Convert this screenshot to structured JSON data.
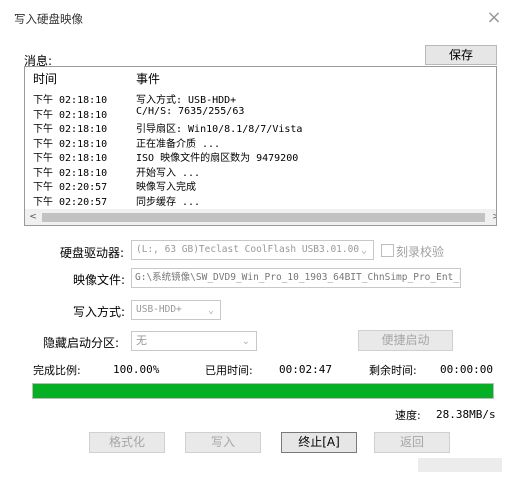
{
  "window": {
    "title": "写入硬盘映像",
    "close_glyph": "×"
  },
  "log": {
    "label": "消息:",
    "save_button": "保存",
    "columns": {
      "time": "时间",
      "event": "事件"
    },
    "rows": [
      {
        "time": "下午 02:18:10",
        "event": "写入方式: USB-HDD+"
      },
      {
        "time": "下午 02:18:10",
        "event": "C/H/S: 7635/255/63"
      },
      {
        "time": "下午 02:18:10",
        "event": "引导扇区: Win10/8.1/8/7/Vista"
      },
      {
        "time": "下午 02:18:10",
        "event": "正在准备介质 ..."
      },
      {
        "time": "下午 02:18:10",
        "event": "ISO 映像文件的扇区数为 9479200"
      },
      {
        "time": "下午 02:18:10",
        "event": "开始写入 ..."
      },
      {
        "time": "下午 02:20:57",
        "event": "映像写入完成"
      },
      {
        "time": "下午 02:20:57",
        "event": "同步缓存 ..."
      }
    ],
    "scroll_up": "^",
    "scroll_down": "v",
    "scroll_left": "<",
    "scroll_right": ">"
  },
  "form": {
    "drive_label": "硬盘驱动器:",
    "drive_value": "(L:, 63 GB)Teclast CoolFlash USB3.01.00",
    "verify_label": "刻录校验",
    "image_label": "映像文件:",
    "image_value": "G:\\系统镜像\\SW_DVD9_Win_Pro_10_1903_64BIT_ChnSimp_Pro_Ent_E",
    "write_mode_label": "写入方式:",
    "write_mode_value": "USB-HDD+",
    "hidden_partition_label": "隐藏启动分区:",
    "hidden_partition_value": "无",
    "quick_boot_button": "便捷启动"
  },
  "status": {
    "ratio_label": "完成比例:",
    "ratio_value": "100.00%",
    "elapsed_label": "已用时间:",
    "elapsed_value": "00:02:47",
    "remaining_label": "剩余时间:",
    "remaining_value": "00:00:00",
    "progress": 1.0,
    "progress_color": "#06b025",
    "speed_label": "速度:",
    "speed_value": "28.38MB/s"
  },
  "buttons": {
    "format": "格式化",
    "write": "写入",
    "stop": "终止[A]",
    "back": "返回"
  }
}
